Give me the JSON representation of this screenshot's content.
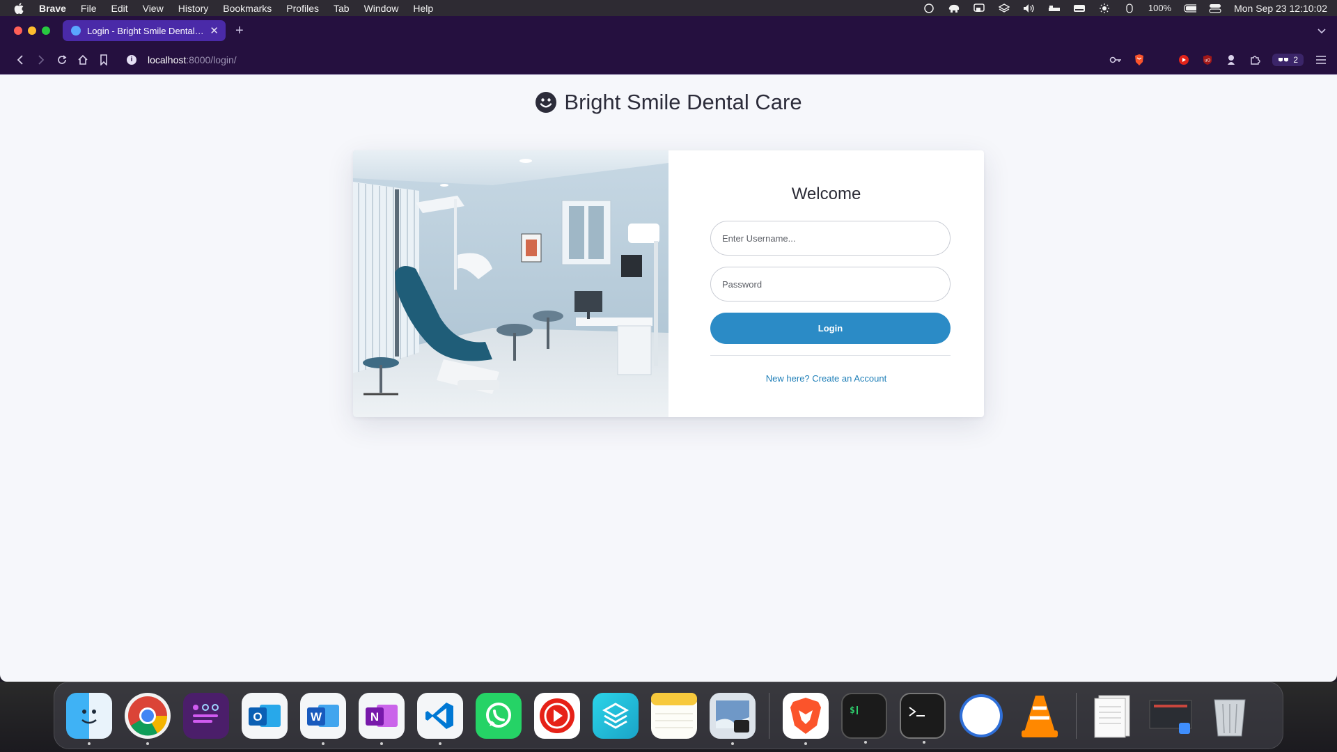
{
  "menubar": {
    "app_name": "Brave",
    "items": [
      "File",
      "Edit",
      "View",
      "History",
      "Bookmarks",
      "Profiles",
      "Tab",
      "Window",
      "Help"
    ],
    "battery": "100%",
    "clock": "Mon Sep 23  12:10:02"
  },
  "browser": {
    "tab_title": "Login - Bright Smile Dental Care",
    "url_host": "localhost",
    "url_path": ":8000/login/",
    "wallet_count": "2"
  },
  "page": {
    "brand_title": "Bright Smile Dental Care",
    "welcome": "Welcome",
    "username_placeholder": "Enter Username...",
    "password_placeholder": "Password",
    "login_label": "Login",
    "signup_link": "New here? Create an Account"
  },
  "dock": {
    "apps": [
      "finder-icon",
      "chrome-icon",
      "launchpad-icon",
      "outlook-icon",
      "word-icon",
      "onenote-icon",
      "vscode-icon",
      "whatsapp-icon",
      "youtube-icon",
      "shortcuts-icon",
      "notes-icon",
      "preview-icon",
      "brave-icon",
      "terminal-icon",
      "terminal-icon",
      "safari-icon",
      "vlc-icon",
      "documents-icon",
      "screenshot-icon",
      "trash-icon"
    ]
  },
  "colors": {
    "accent": "#2b8bc6",
    "link": "#1f7fb8",
    "browser_chrome": "#25103f",
    "active_tab": "#4a2aa8",
    "page_bg": "#f6f7fb"
  }
}
